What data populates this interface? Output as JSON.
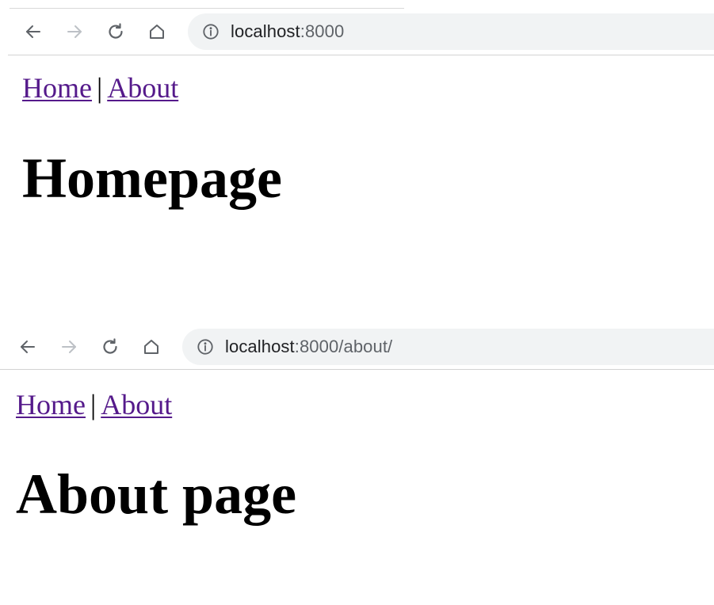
{
  "windows": [
    {
      "url_host": "localhost",
      "url_rest": ":8000",
      "nav_links": {
        "home": "Home",
        "separator": "|",
        "about": "About"
      },
      "heading": "Homepage"
    },
    {
      "url_host": "localhost",
      "url_rest": ":8000/about/",
      "nav_links": {
        "home": "Home",
        "separator": "|",
        "about": "About"
      },
      "heading": "About page"
    }
  ],
  "colors": {
    "visited_link": "#551a8b",
    "omnibox_background": "#f1f3f4",
    "icon_active": "#5f6368",
    "icon_disabled": "#bdc1c6"
  },
  "icons": [
    "back-arrow-icon",
    "forward-arrow-icon",
    "reload-icon",
    "home-icon",
    "info-icon"
  ]
}
